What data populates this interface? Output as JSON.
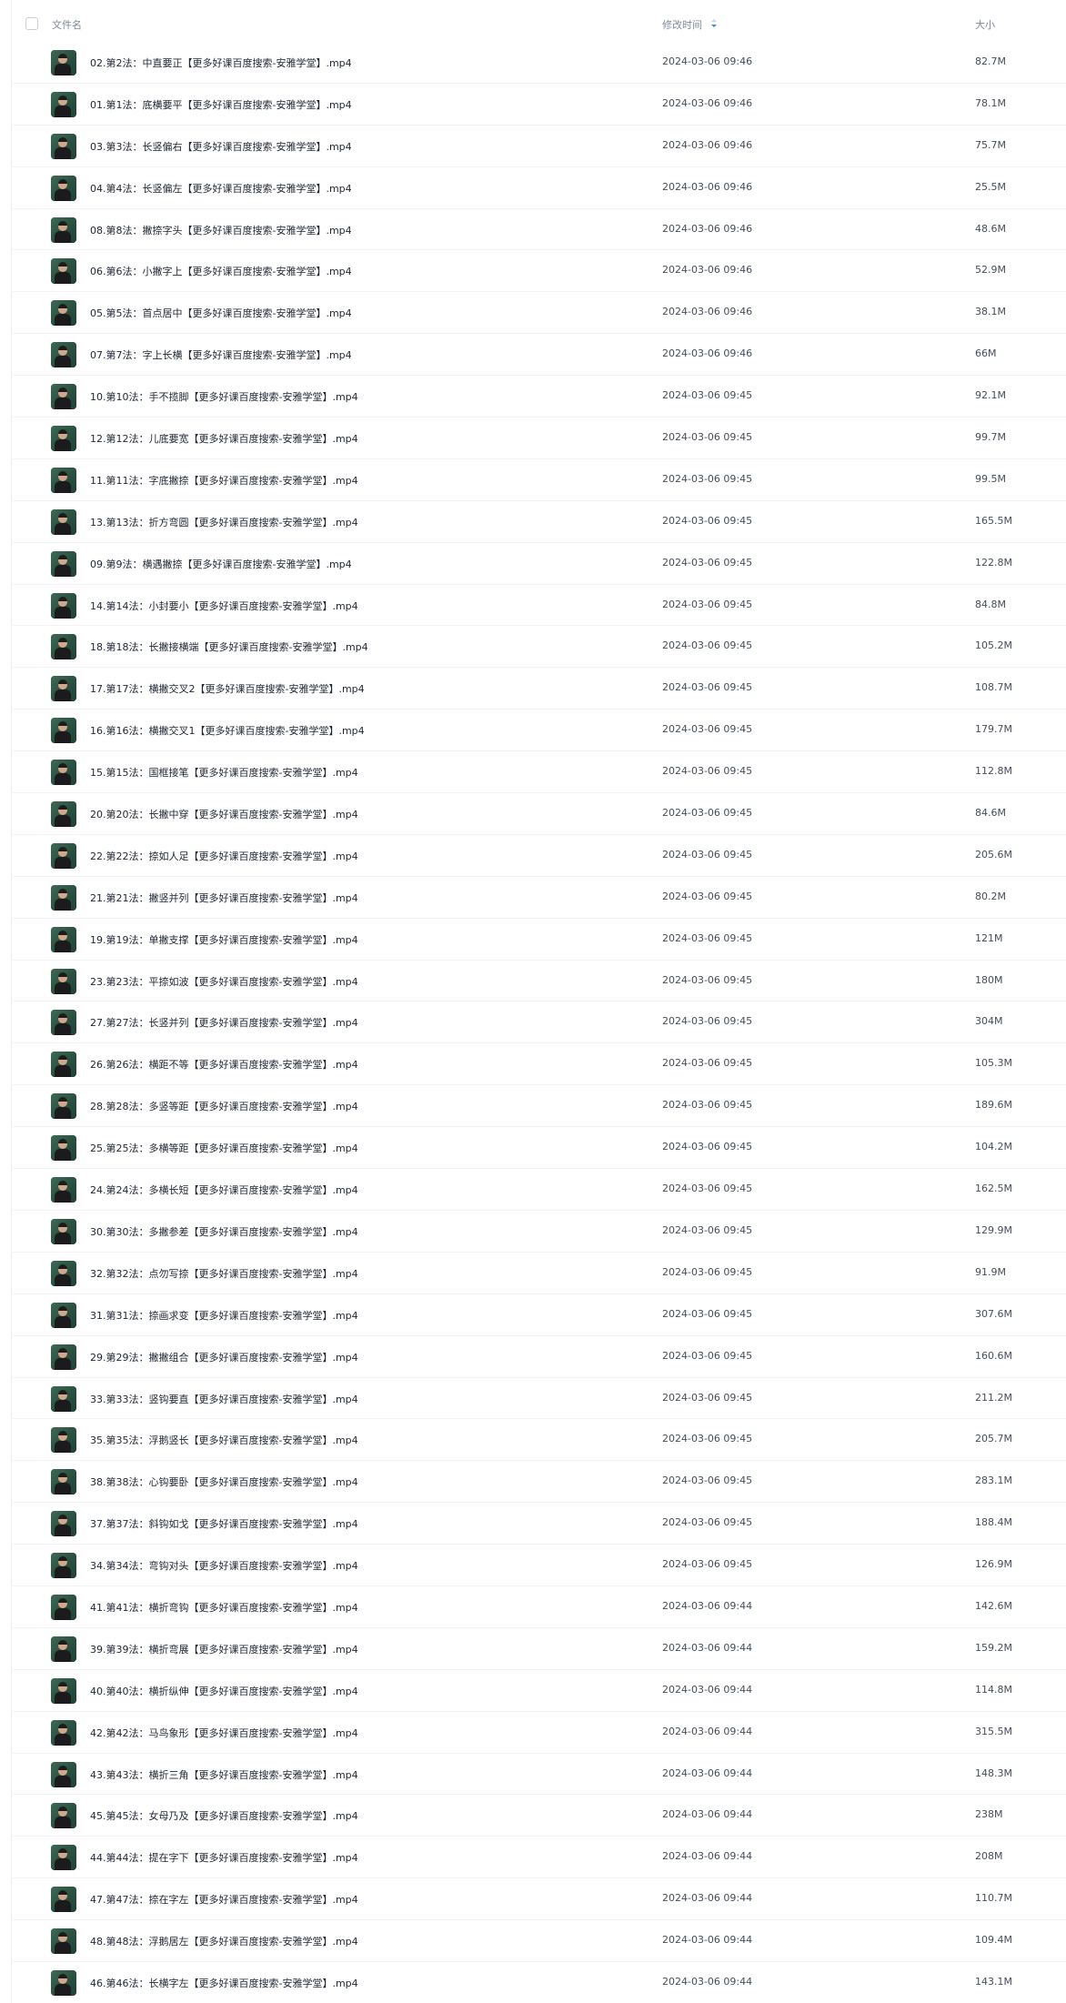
{
  "header": {
    "name_label": "文件名",
    "time_label": "修改时间",
    "size_label": "大小",
    "sort_icon": "sort-descending-icon",
    "sort_color": "#2e8cf0"
  },
  "files": [
    {
      "name": "02.第2法：中直要正【更多好课百度搜索-安雅学堂】.mp4",
      "time": "2024-03-06 09:46",
      "size": "82.7M"
    },
    {
      "name": "01.第1法：底横要平【更多好课百度搜索-安雅学堂】.mp4",
      "time": "2024-03-06 09:46",
      "size": "78.1M"
    },
    {
      "name": "03.第3法：长竖偏右【更多好课百度搜索-安雅学堂】.mp4",
      "time": "2024-03-06 09:46",
      "size": "75.7M"
    },
    {
      "name": "04.第4法：长竖偏左【更多好课百度搜索-安雅学堂】.mp4",
      "time": "2024-03-06 09:46",
      "size": "25.5M"
    },
    {
      "name": "08.第8法：撇捺字头【更多好课百度搜索-安雅学堂】.mp4",
      "time": "2024-03-06 09:46",
      "size": "48.6M"
    },
    {
      "name": "06.第6法：小撇字上【更多好课百度搜索-安雅学堂】.mp4",
      "time": "2024-03-06 09:46",
      "size": "52.9M"
    },
    {
      "name": "05.第5法：首点居中【更多好课百度搜索-安雅学堂】.mp4",
      "time": "2024-03-06 09:46",
      "size": "38.1M"
    },
    {
      "name": "07.第7法：字上长横【更多好课百度搜索-安雅学堂】.mp4",
      "time": "2024-03-06 09:46",
      "size": "66M"
    },
    {
      "name": "10.第10法：手不揽脚【更多好课百度搜索-安雅学堂】.mp4",
      "time": "2024-03-06 09:45",
      "size": "92.1M"
    },
    {
      "name": "12.第12法：儿底要宽【更多好课百度搜索-安雅学堂】.mp4",
      "time": "2024-03-06 09:45",
      "size": "99.7M"
    },
    {
      "name": "11.第11法：字底撇捺【更多好课百度搜索-安雅学堂】.mp4",
      "time": "2024-03-06 09:45",
      "size": "99.5M"
    },
    {
      "name": "13.第13法：折方弯圆【更多好课百度搜索-安雅学堂】.mp4",
      "time": "2024-03-06 09:45",
      "size": "165.5M"
    },
    {
      "name": "09.第9法：横遇撇捺【更多好课百度搜索-安雅学堂】.mp4",
      "time": "2024-03-06 09:45",
      "size": "122.8M"
    },
    {
      "name": "14.第14法：小封要小【更多好课百度搜索-安雅学堂】.mp4",
      "time": "2024-03-06 09:45",
      "size": "84.8M"
    },
    {
      "name": "18.第18法：长撇接横端【更多好课百度搜索-安雅学堂】.mp4",
      "time": "2024-03-06 09:45",
      "size": "105.2M"
    },
    {
      "name": "17.第17法：横撇交叉2【更多好课百度搜索-安雅学堂】.mp4",
      "time": "2024-03-06 09:45",
      "size": "108.7M"
    },
    {
      "name": "16.第16法：横撇交叉1【更多好课百度搜索-安雅学堂】.mp4",
      "time": "2024-03-06 09:45",
      "size": "179.7M"
    },
    {
      "name": "15.第15法：国框接笔【更多好课百度搜索-安雅学堂】.mp4",
      "time": "2024-03-06 09:45",
      "size": "112.8M"
    },
    {
      "name": "20.第20法：长撇中穿【更多好课百度搜索-安雅学堂】.mp4",
      "time": "2024-03-06 09:45",
      "size": "84.6M"
    },
    {
      "name": "22.第22法：捺如人足【更多好课百度搜索-安雅学堂】.mp4",
      "time": "2024-03-06 09:45",
      "size": "205.6M"
    },
    {
      "name": "21.第21法：撇竖并列【更多好课百度搜索-安雅学堂】.mp4",
      "time": "2024-03-06 09:45",
      "size": "80.2M"
    },
    {
      "name": "19.第19法：单撇支撑【更多好课百度搜索-安雅学堂】.mp4",
      "time": "2024-03-06 09:45",
      "size": "121M"
    },
    {
      "name": "23.第23法：平捺如波【更多好课百度搜索-安雅学堂】.mp4",
      "time": "2024-03-06 09:45",
      "size": "180M"
    },
    {
      "name": "27.第27法：长竖并列【更多好课百度搜索-安雅学堂】.mp4",
      "time": "2024-03-06 09:45",
      "size": "304M"
    },
    {
      "name": "26.第26法：横距不等【更多好课百度搜索-安雅学堂】.mp4",
      "time": "2024-03-06 09:45",
      "size": "105.3M"
    },
    {
      "name": "28.第28法：多竖等距【更多好课百度搜索-安雅学堂】.mp4",
      "time": "2024-03-06 09:45",
      "size": "189.6M"
    },
    {
      "name": "25.第25法：多横等距【更多好课百度搜索-安雅学堂】.mp4",
      "time": "2024-03-06 09:45",
      "size": "104.2M"
    },
    {
      "name": "24.第24法：多横长短【更多好课百度搜索-安雅学堂】.mp4",
      "time": "2024-03-06 09:45",
      "size": "162.5M"
    },
    {
      "name": "30.第30法：多撇参差【更多好课百度搜索-安雅学堂】.mp4",
      "time": "2024-03-06 09:45",
      "size": "129.9M"
    },
    {
      "name": "32.第32法：点勿写捺【更多好课百度搜索-安雅学堂】.mp4",
      "time": "2024-03-06 09:45",
      "size": "91.9M"
    },
    {
      "name": "31.第31法：捺画求变【更多好课百度搜索-安雅学堂】.mp4",
      "time": "2024-03-06 09:45",
      "size": "307.6M"
    },
    {
      "name": "29.第29法：撇撇组合【更多好课百度搜索-安雅学堂】.mp4",
      "time": "2024-03-06 09:45",
      "size": "160.6M"
    },
    {
      "name": "33.第33法：竖钩要直【更多好课百度搜索-安雅学堂】.mp4",
      "time": "2024-03-06 09:45",
      "size": "211.2M"
    },
    {
      "name": "35.第35法：浮鹅竖长【更多好课百度搜索-安雅学堂】.mp4",
      "time": "2024-03-06 09:45",
      "size": "205.7M"
    },
    {
      "name": "38.第38法：心钩要卧【更多好课百度搜索-安雅学堂】.mp4",
      "time": "2024-03-06 09:45",
      "size": "283.1M"
    },
    {
      "name": "37.第37法：斜钩如戈【更多好课百度搜索-安雅学堂】.mp4",
      "time": "2024-03-06 09:45",
      "size": "188.4M"
    },
    {
      "name": "34.第34法：弯钩对头【更多好课百度搜索-安雅学堂】.mp4",
      "time": "2024-03-06 09:45",
      "size": "126.9M"
    },
    {
      "name": "41.第41法：横折弯钩【更多好课百度搜索-安雅学堂】.mp4",
      "time": "2024-03-06 09:44",
      "size": "142.6M"
    },
    {
      "name": "39.第39法：横折弯展【更多好课百度搜索-安雅学堂】.mp4",
      "time": "2024-03-06 09:44",
      "size": "159.2M"
    },
    {
      "name": "40.第40法：横折纵伸【更多好课百度搜索-安雅学堂】.mp4",
      "time": "2024-03-06 09:44",
      "size": "114.8M"
    },
    {
      "name": "42.第42法：马鸟象形【更多好课百度搜索-安雅学堂】.mp4",
      "time": "2024-03-06 09:44",
      "size": "315.5M"
    },
    {
      "name": "43.第43法：横折三角【更多好课百度搜索-安雅学堂】.mp4",
      "time": "2024-03-06 09:44",
      "size": "148.3M"
    },
    {
      "name": "45.第45法：女母乃及【更多好课百度搜索-安雅学堂】.mp4",
      "time": "2024-03-06 09:44",
      "size": "238M"
    },
    {
      "name": "44.第44法：提在字下【更多好课百度搜索-安雅学堂】.mp4",
      "time": "2024-03-06 09:44",
      "size": "208M"
    },
    {
      "name": "47.第47法：捺在字左【更多好课百度搜索-安雅学堂】.mp4",
      "time": "2024-03-06 09:44",
      "size": "110.7M"
    },
    {
      "name": "48.第48法：浮鹅居左【更多好课百度搜索-安雅学堂】.mp4",
      "time": "2024-03-06 09:44",
      "size": "109.4M"
    },
    {
      "name": "46.第46法：长横字左【更多好课百度搜索-安雅学堂】.mp4",
      "time": "2024-03-06 09:44",
      "size": "143.1M"
    }
  ]
}
